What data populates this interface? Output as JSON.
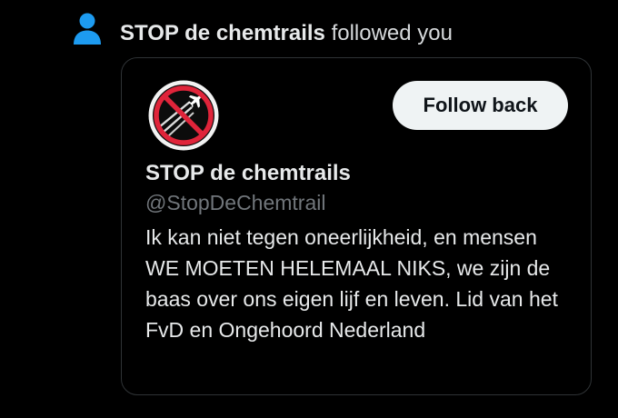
{
  "notification": {
    "icon": "person-icon",
    "actor_name": "STOP de chemtrails",
    "action_text": "followed you"
  },
  "user_card": {
    "avatar_icon": "no-chemtrails-icon",
    "follow_button_label": "Follow back",
    "display_name": "STOP de chemtrails",
    "handle": "@StopDeChemtrail",
    "bio": "Ik kan niet tegen oneerlijkheid, en mensen WE MOETEN HELEMAAL NIKS, we zijn de baas over ons eigen lijf en leven. Lid van het FvD en Ongehoord Nederland"
  },
  "colors": {
    "background": "#000000",
    "accent_icon": "#1d9bf0",
    "text_primary": "#e7e9ea",
    "text_secondary": "#71767b",
    "button_bg": "#eff3f4",
    "prohibition_red": "#e0243a"
  }
}
